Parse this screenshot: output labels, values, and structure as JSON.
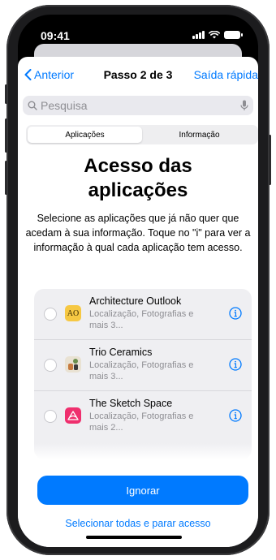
{
  "status_bar": {
    "time": "09:41"
  },
  "nav": {
    "back_label": "Anterior",
    "title": "Passo 2 de 3",
    "exit_label": "Saída rápida"
  },
  "search": {
    "placeholder": "Pesquisa"
  },
  "tabs": [
    {
      "label": "Aplicações",
      "selected": true
    },
    {
      "label": "Informação",
      "selected": false
    }
  ],
  "heading": {
    "line1": "Acesso das",
    "line2": "aplicações"
  },
  "description": "Selecione as aplicações que já não quer que acedam à sua informação. Toque no \"i\" para ver a informação à qual cada aplicação tem acesso.",
  "apps": [
    {
      "name": "Architecture Outlook",
      "subtitle": "Localização, Fotografias e mais 3...",
      "icon": "architecture-outlook-app-icon",
      "icon_text": "AO",
      "icon_color": "#f6c843"
    },
    {
      "name": "Trio Ceramics",
      "subtitle": "Localização, Fotografias e mais 3...",
      "icon": "trio-ceramics-app-icon",
      "icon_color": "#e9e2d3"
    },
    {
      "name": "The Sketch Space",
      "subtitle": "Localização, Fotografias e mais 2...",
      "icon": "sketch-space-app-icon",
      "icon_color": "#ef2f6e"
    }
  ],
  "actions": {
    "primary_label": "Ignorar",
    "secondary_label": "Selecionar todas e parar acesso"
  },
  "colors": {
    "accent": "#007aff",
    "list_bg": "#efeff2"
  }
}
